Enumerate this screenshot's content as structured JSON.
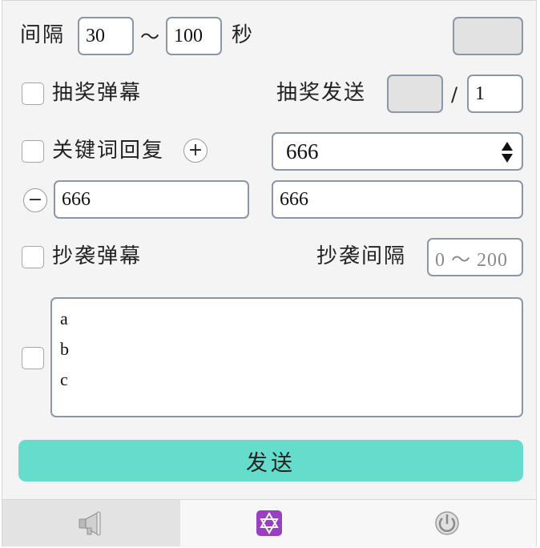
{
  "interval": {
    "label": "间隔",
    "min": "30",
    "tilde": "～",
    "max": "100",
    "unit": "秒"
  },
  "lottery": {
    "label": "抽奖弹幕",
    "send_label": "抽奖发送",
    "count_value": "",
    "slash": "/",
    "total_value": "1"
  },
  "keyword": {
    "label": "关键词回复",
    "add_symbol": "+",
    "remove_symbol": "−",
    "select_value": "666",
    "keyword_value": "666",
    "reply_value": "666"
  },
  "copy": {
    "label": "抄袭弹幕",
    "interval_label": "抄袭间隔",
    "interval_placeholder": "0 ～ 200"
  },
  "messages": {
    "lines": [
      "a",
      "b",
      "c"
    ]
  },
  "send_button": {
    "label": "发送"
  },
  "tabs": [
    {
      "icon": "megaphone-icon",
      "active": true
    },
    {
      "icon": "star-of-david-icon",
      "active": false
    },
    {
      "icon": "power-icon",
      "active": false
    }
  ],
  "colors": {
    "send_button": "#66dccc",
    "star_badge": "#9b3fc1",
    "input_border": "#8a97a6"
  }
}
